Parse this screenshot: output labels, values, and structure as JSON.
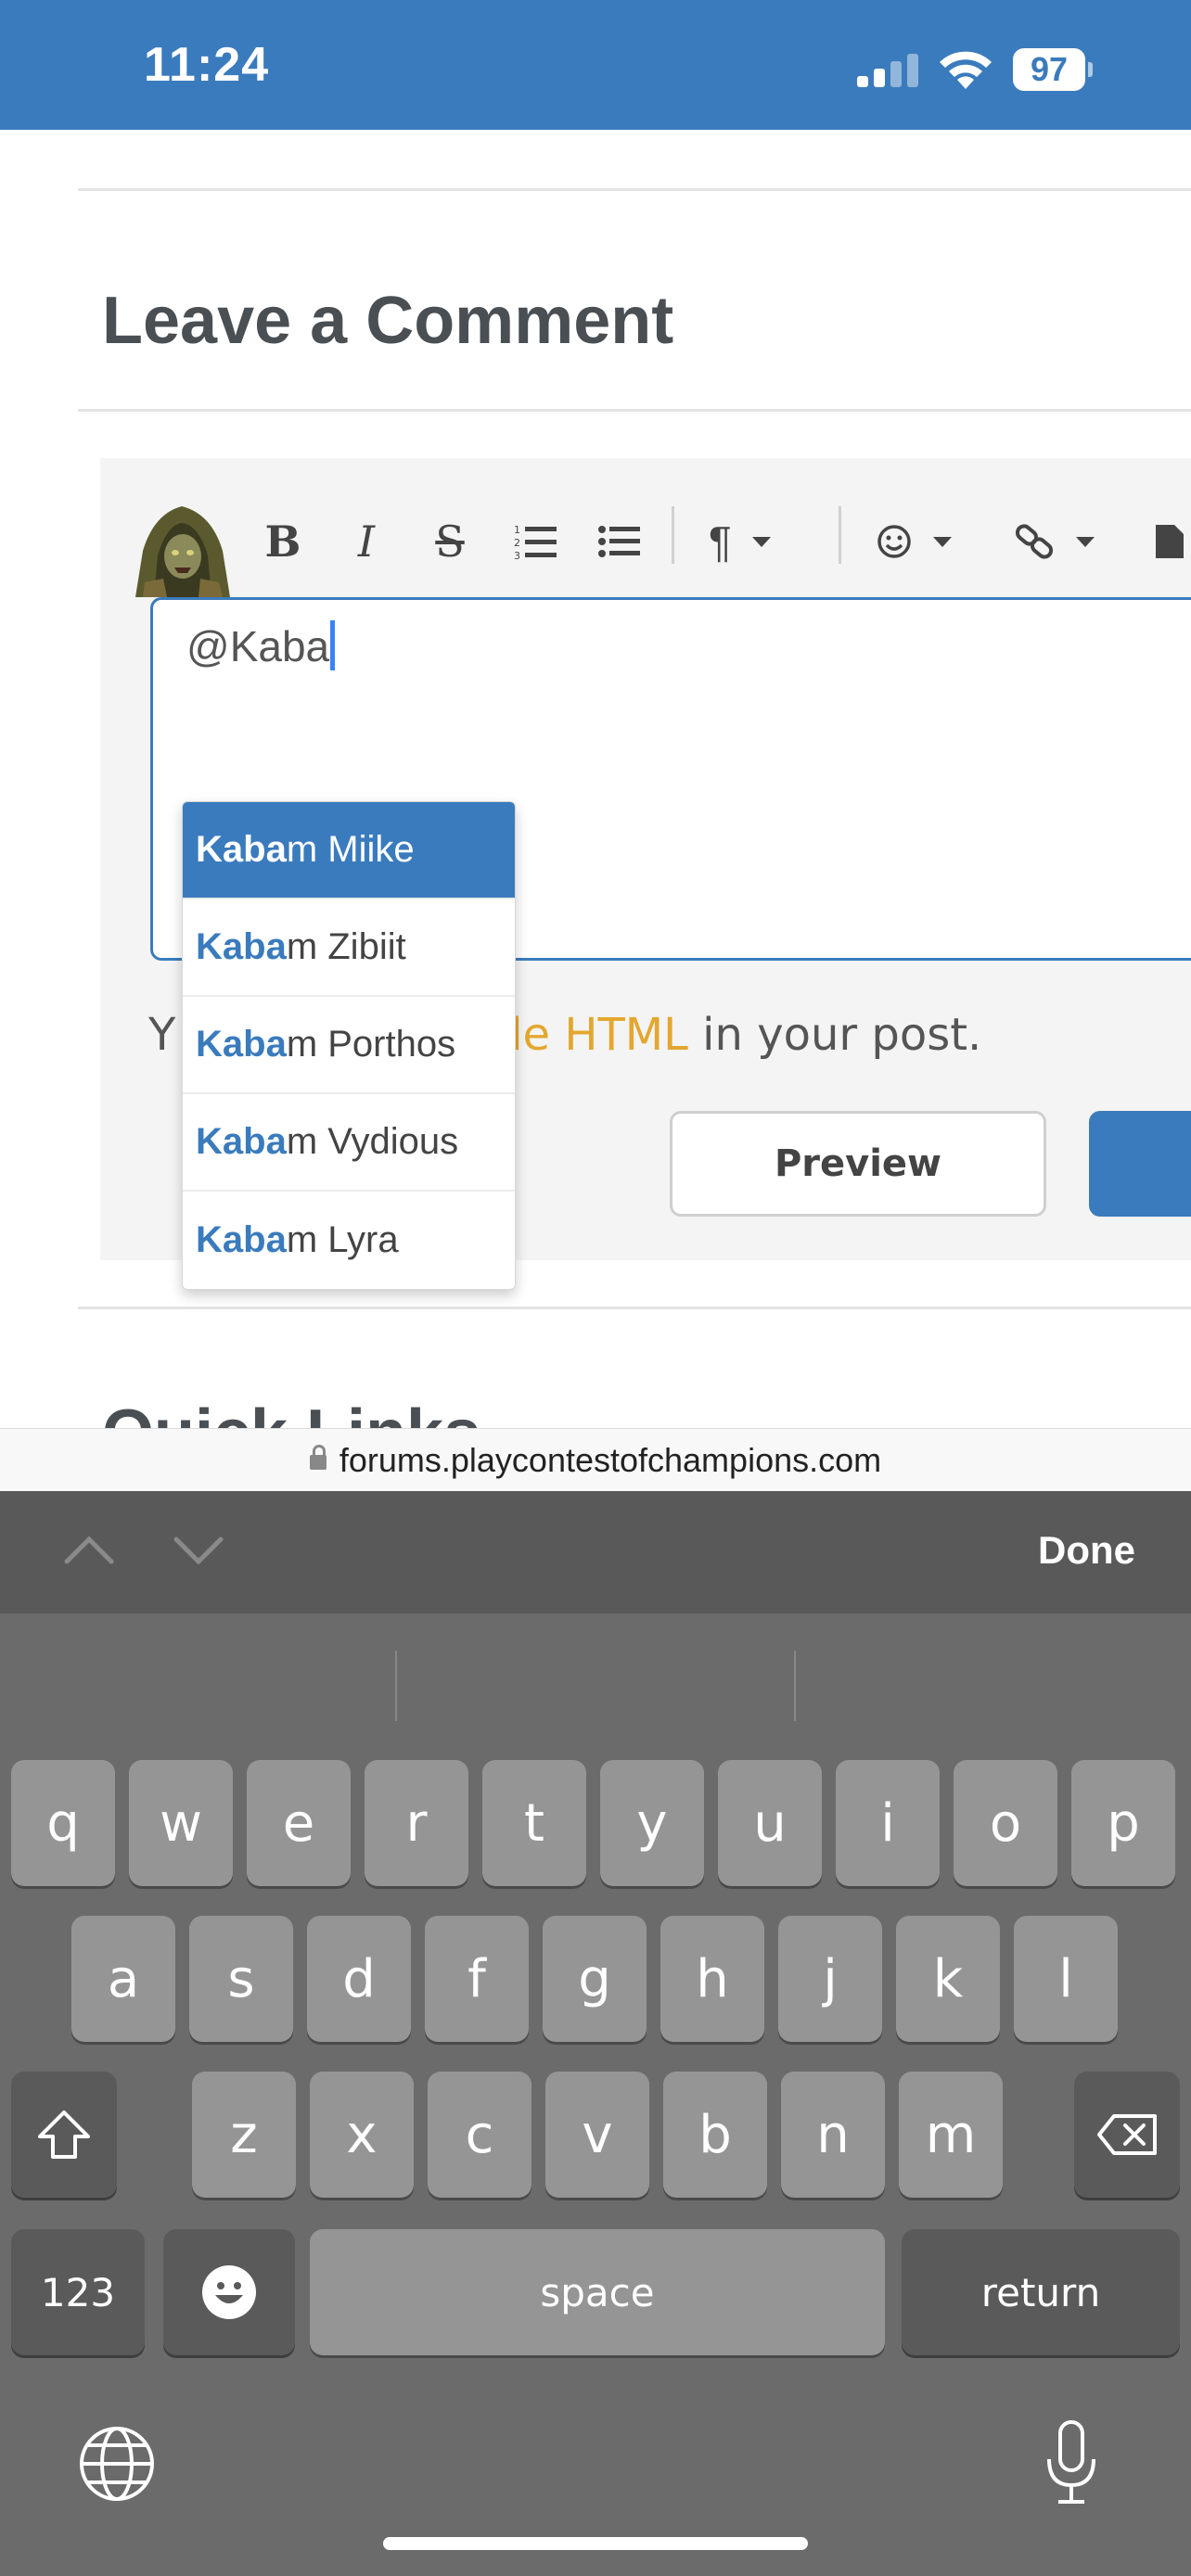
{
  "status_bar": {
    "time": "11:24",
    "battery": "97"
  },
  "page": {
    "comment_title": "Leave a Comment",
    "editor": {
      "input_value": "@Kaba",
      "helper_prefix": "Y",
      "helper_link": "nple HTML",
      "helper_suffix": " in your post.",
      "preview_label": "Preview"
    },
    "mentions": [
      {
        "match": "Kaba",
        "rest": "m Miike"
      },
      {
        "match": "Kaba",
        "rest": "m Zibiit"
      },
      {
        "match": "Kaba",
        "rest": "m Porthos"
      },
      {
        "match": "Kaba",
        "rest": "m Vydious"
      },
      {
        "match": "Kaba",
        "rest": "m Lyra"
      }
    ],
    "quick_links_title": "Quick Links"
  },
  "url": "forums.playcontestofchampions.com",
  "accessory": {
    "done_label": "Done"
  },
  "keyboard": {
    "row1": [
      "q",
      "w",
      "e",
      "r",
      "t",
      "y",
      "u",
      "i",
      "o",
      "p"
    ],
    "row2": [
      "a",
      "s",
      "d",
      "f",
      "g",
      "h",
      "j",
      "k",
      "l"
    ],
    "row3": [
      "z",
      "x",
      "c",
      "v",
      "b",
      "n",
      "m"
    ],
    "numbers_label": "123",
    "space_label": "space",
    "return_label": "return"
  },
  "colors": {
    "accent": "#3a7bbd",
    "link": "#e3a72f",
    "keyboard_bg": "#6b6b6b"
  }
}
